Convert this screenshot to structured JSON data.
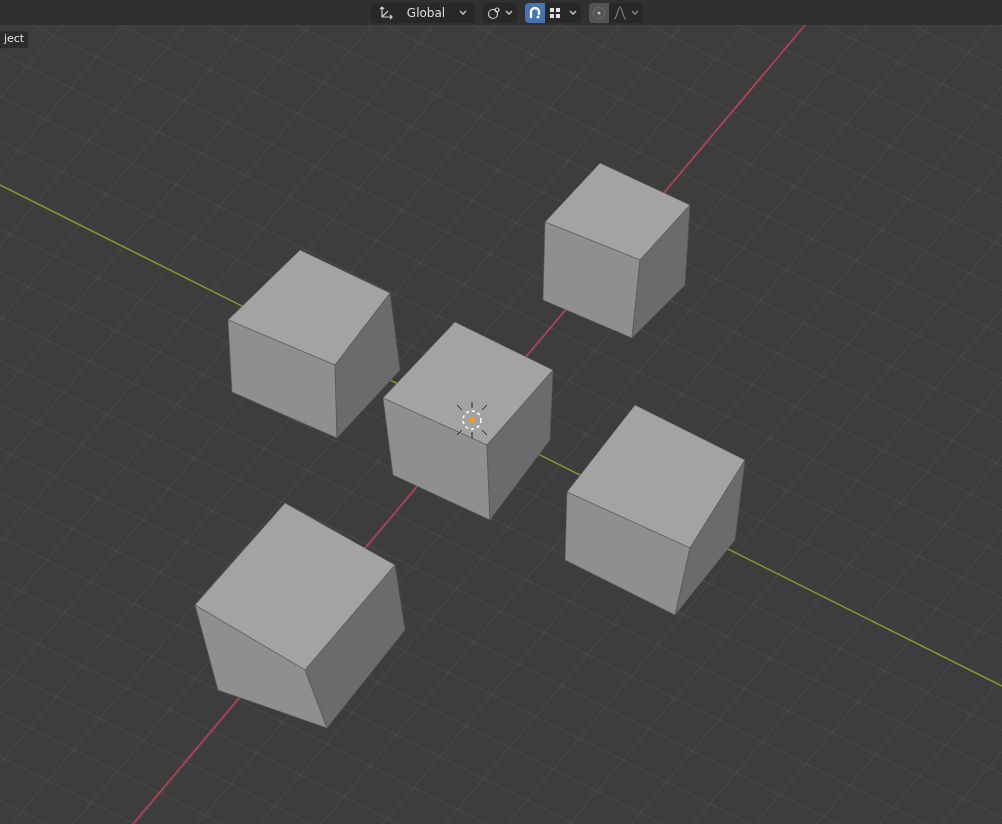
{
  "header": {
    "transform_orientation": {
      "label": "Global"
    },
    "snap": {
      "on": true
    },
    "proportional_editing": {
      "on": false
    }
  },
  "viewport": {
    "mode_label": "ject"
  }
}
